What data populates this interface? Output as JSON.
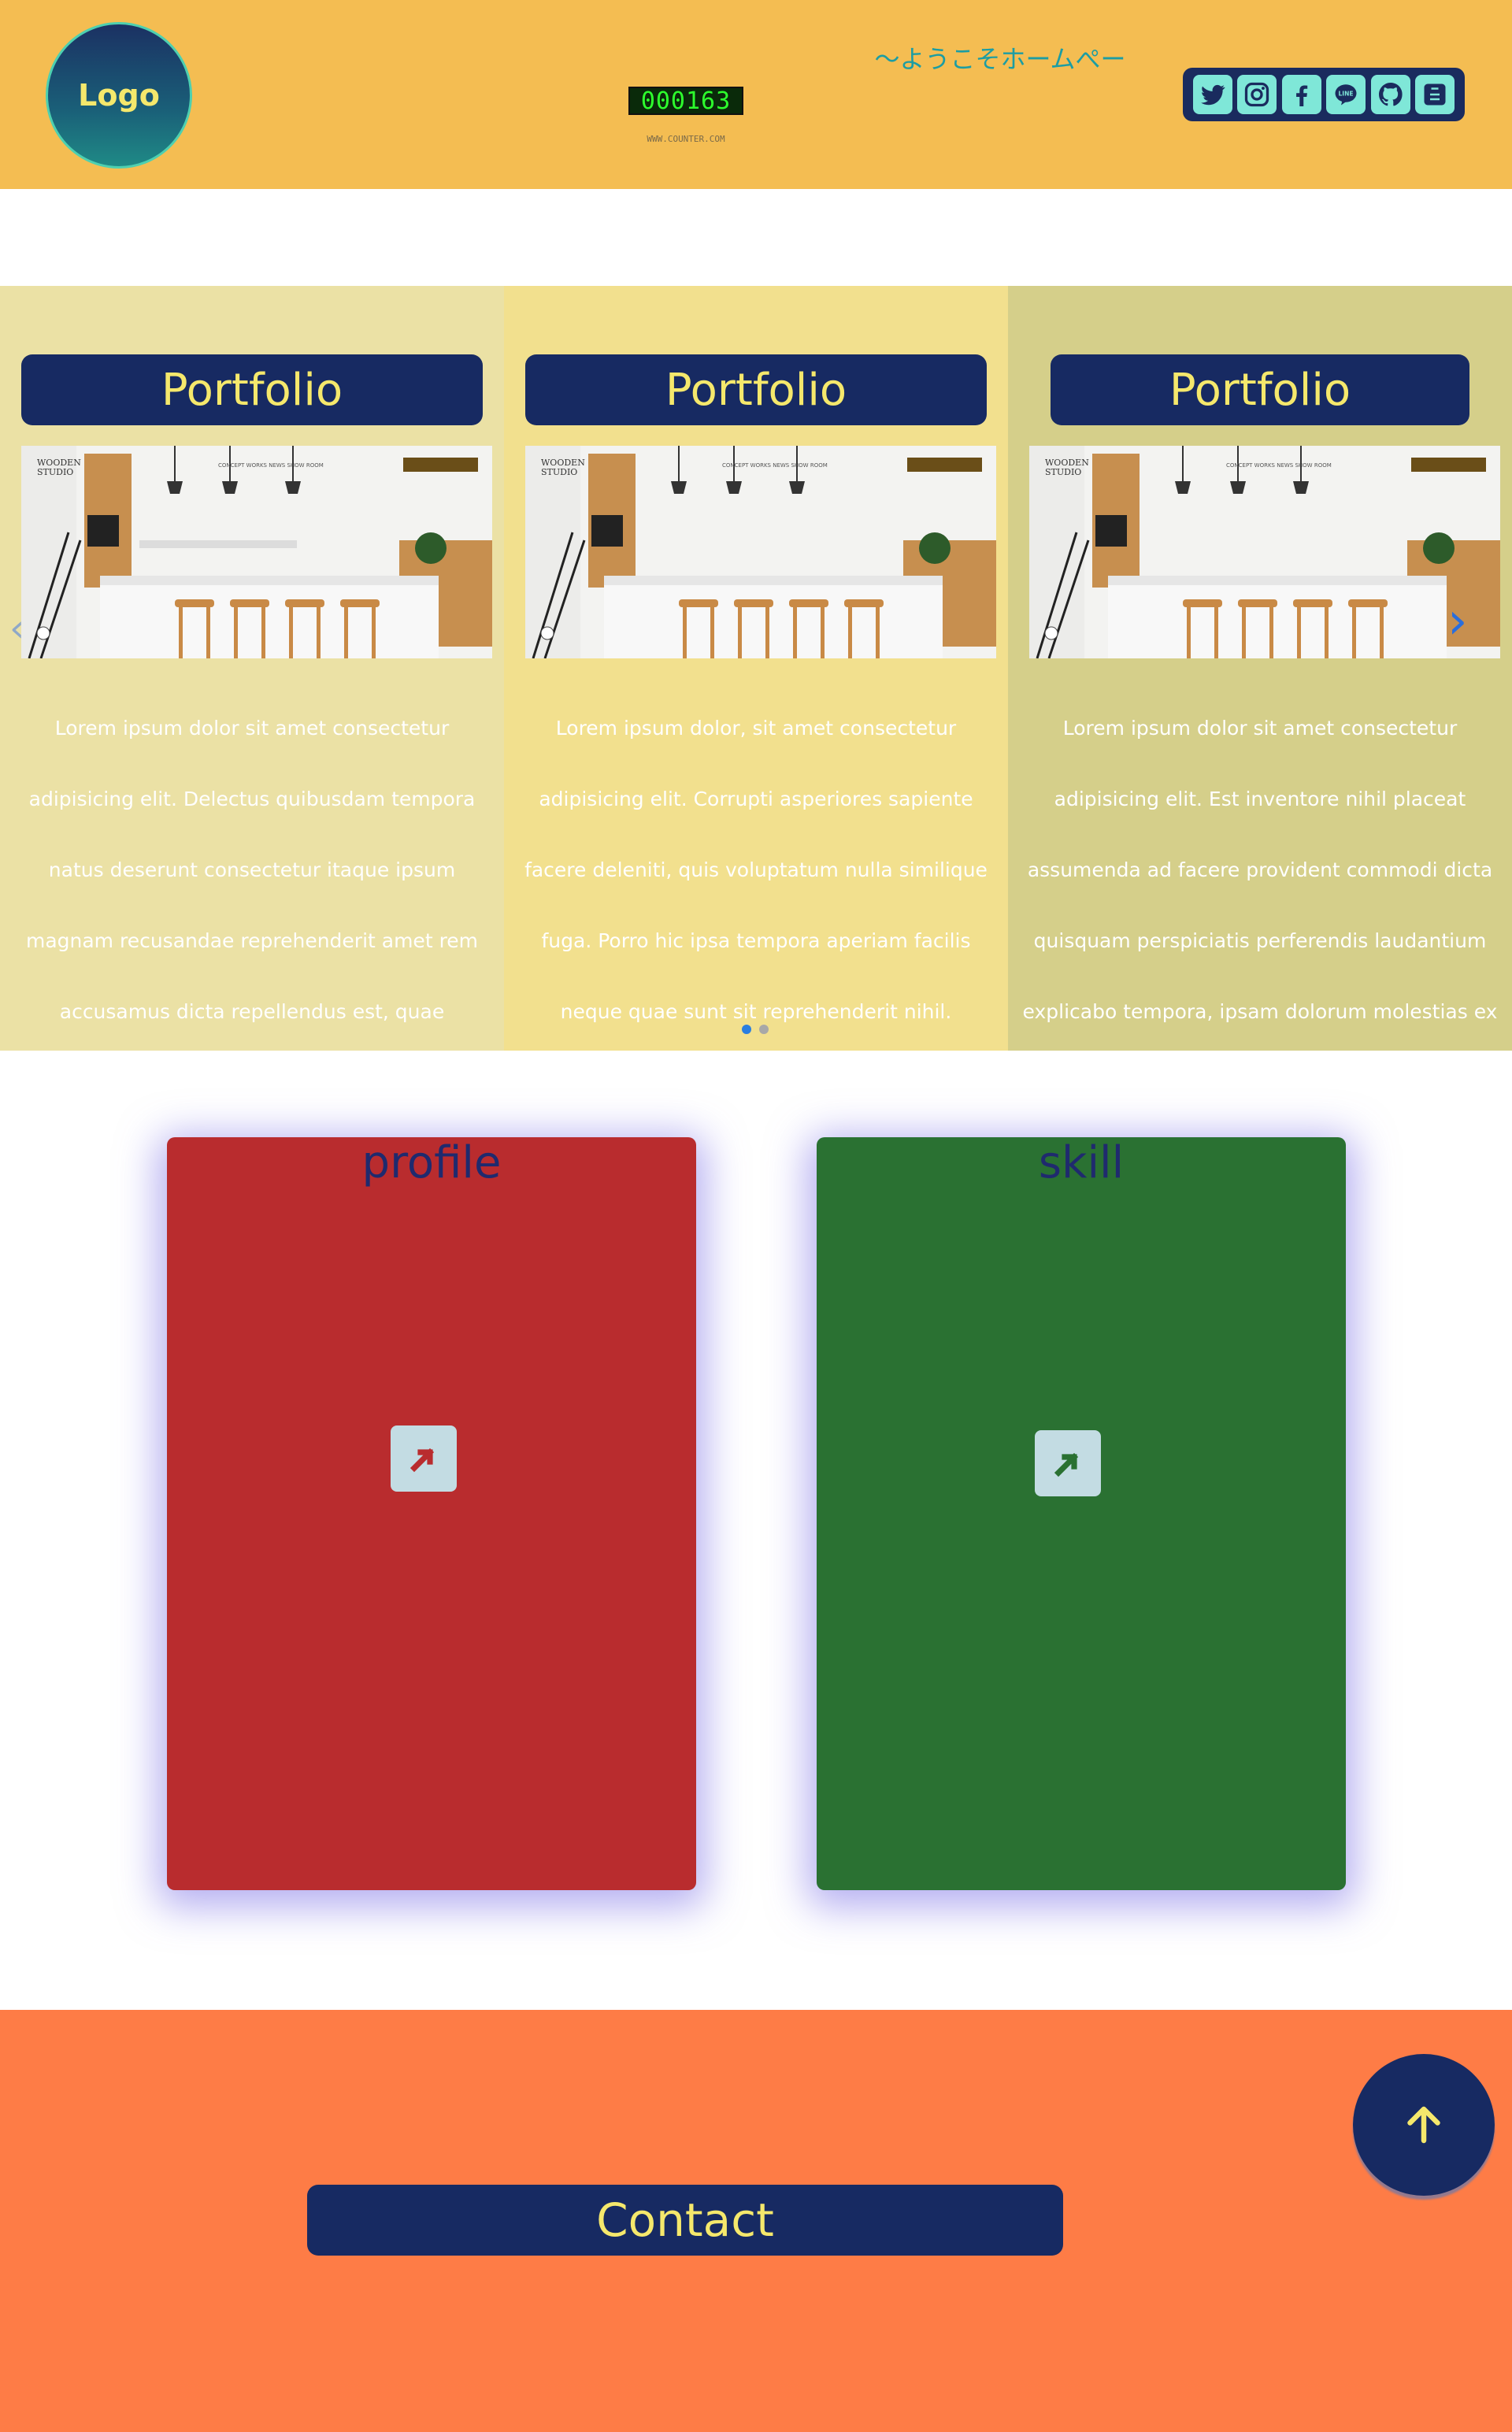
{
  "header": {
    "logo_text": "Logo",
    "counter_value": "000163",
    "counter_caption": "WWW.COUNTER.COM",
    "welcome_text": "〜ようこそホームぺー",
    "social_icons": [
      "twitter-icon",
      "instagram-icon",
      "facebook-icon",
      "line-icon",
      "github-icon",
      "share-icon"
    ]
  },
  "portfolio": {
    "items": [
      {
        "button_label": "Portfolio",
        "image_brand": "WOODEN STUDIO",
        "text": "Lorem ipsum dolor sit amet consectetur adipisicing elit. Delectus quibusdam tempora natus deserunt consectetur itaque ipsum magnam recusandae reprehenderit amet rem accusamus dicta repellendus est, quae provident?"
      },
      {
        "button_label": "Portfolio",
        "image_brand": "WOODEN STUDIO",
        "text": "Lorem ipsum dolor, sit amet consectetur adipisicing elit. Corrupti asperiores sapiente facere deleniti, quis voluptatum nulla similique fuga. Porro hic ipsa tempora aperiam facilis neque quae sunt sit reprehenderit nihil."
      },
      {
        "button_label": "Portfolio",
        "image_brand": "WOODEN STUDIO",
        "text": "Lorem ipsum dolor sit amet consectetur adipisicing elit. Est inventore nihil placeat assumenda ad facere provident commodi dicta quisquam perspiciatis perferendis laudantium explicabo tempora, ipsam dolorum molestias ex"
      }
    ],
    "prev_arrow": "‹",
    "next_arrow": "›",
    "pagination_active": 1,
    "pagination_count": 2
  },
  "cards": {
    "profile_title": "profile",
    "skill_title": "skill"
  },
  "contact": {
    "button_label": "Contact"
  },
  "colors": {
    "header_bg": "#f4bd52",
    "navy": "#172a62",
    "yellow_text": "#f5e86c",
    "profile_red": "#b92c2e",
    "skill_green": "#2a7132",
    "contact_orange": "#fe7c46"
  }
}
